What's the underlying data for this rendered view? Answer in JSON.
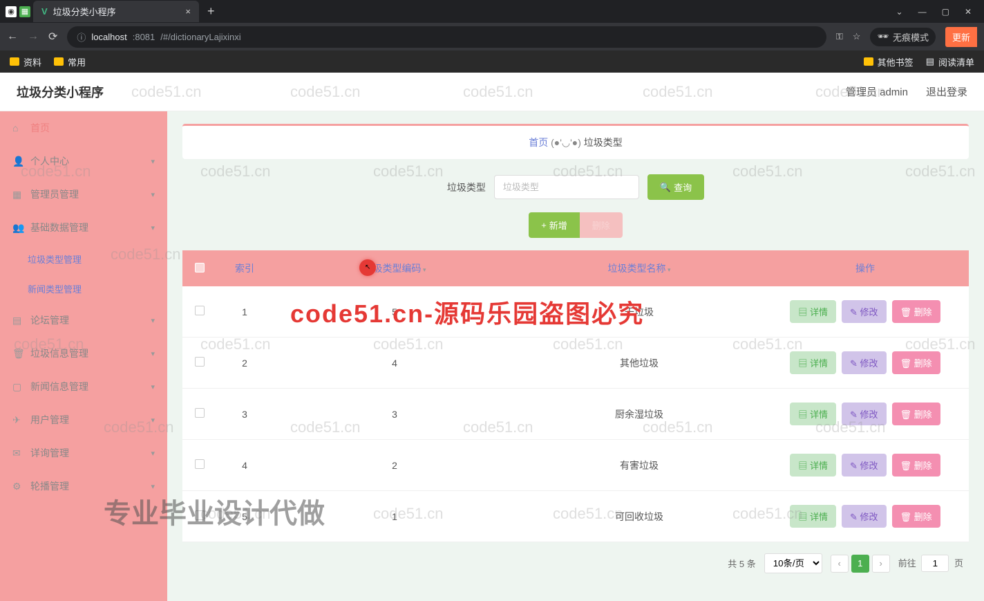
{
  "browser": {
    "tab_title": "垃圾分类小程序",
    "url_host": "localhost",
    "url_port": ":8081",
    "url_path": "/#/dictionaryLajixinxi",
    "incognito": "无痕模式",
    "update": "更新",
    "bookmarks": {
      "b1": "资料",
      "b2": "常用",
      "other": "其他书签",
      "reading": "阅读清单"
    }
  },
  "header": {
    "title": "垃圾分类小程序",
    "user": "管理员 admin",
    "logout": "退出登录"
  },
  "sidebar": {
    "home": "首页",
    "personal": "个人中心",
    "admin": "管理员管理",
    "basedata": "基础数据管理",
    "sub_trash_type": "垃圾类型管理",
    "sub_news_type": "新闻类型管理",
    "forum": "论坛管理",
    "trash_info": "垃圾信息管理",
    "news_info": "新闻信息管理",
    "user_mgmt": "用户管理",
    "comment": "详询管理",
    "route": "轮播管理"
  },
  "breadcrumb": {
    "home": "首页",
    "emo": "(●'◡'●)",
    "current": "垃圾类型"
  },
  "search": {
    "label": "垃圾类型",
    "placeholder": "垃圾类型",
    "btn": "查询"
  },
  "actions": {
    "add": "新增",
    "del": "删除"
  },
  "table": {
    "headers": {
      "index": "索引",
      "code": "垃圾类型编码",
      "name": "垃圾类型名称",
      "ops": "操作"
    },
    "ops": {
      "detail": "详情",
      "edit": "修改",
      "delete": "删除"
    },
    "rows": [
      {
        "idx": "1",
        "code": "5",
        "name": "干垃圾"
      },
      {
        "idx": "2",
        "code": "4",
        "name": "其他垃圾"
      },
      {
        "idx": "3",
        "code": "3",
        "name": "厨余湿垃圾"
      },
      {
        "idx": "4",
        "code": "2",
        "name": "有害垃圾"
      },
      {
        "idx": "5",
        "code": "1",
        "name": "可回收垃圾"
      }
    ]
  },
  "pagination": {
    "total": "共 5 条",
    "page_size": "10条/页",
    "current": "1",
    "jump_pre": "前往",
    "jump_val": "1",
    "jump_suf": "页"
  },
  "watermarks": {
    "red": "code51.cn-源码乐园盗图必究",
    "gray": "专业毕业设计代做",
    "bg": "code51.cn"
  }
}
